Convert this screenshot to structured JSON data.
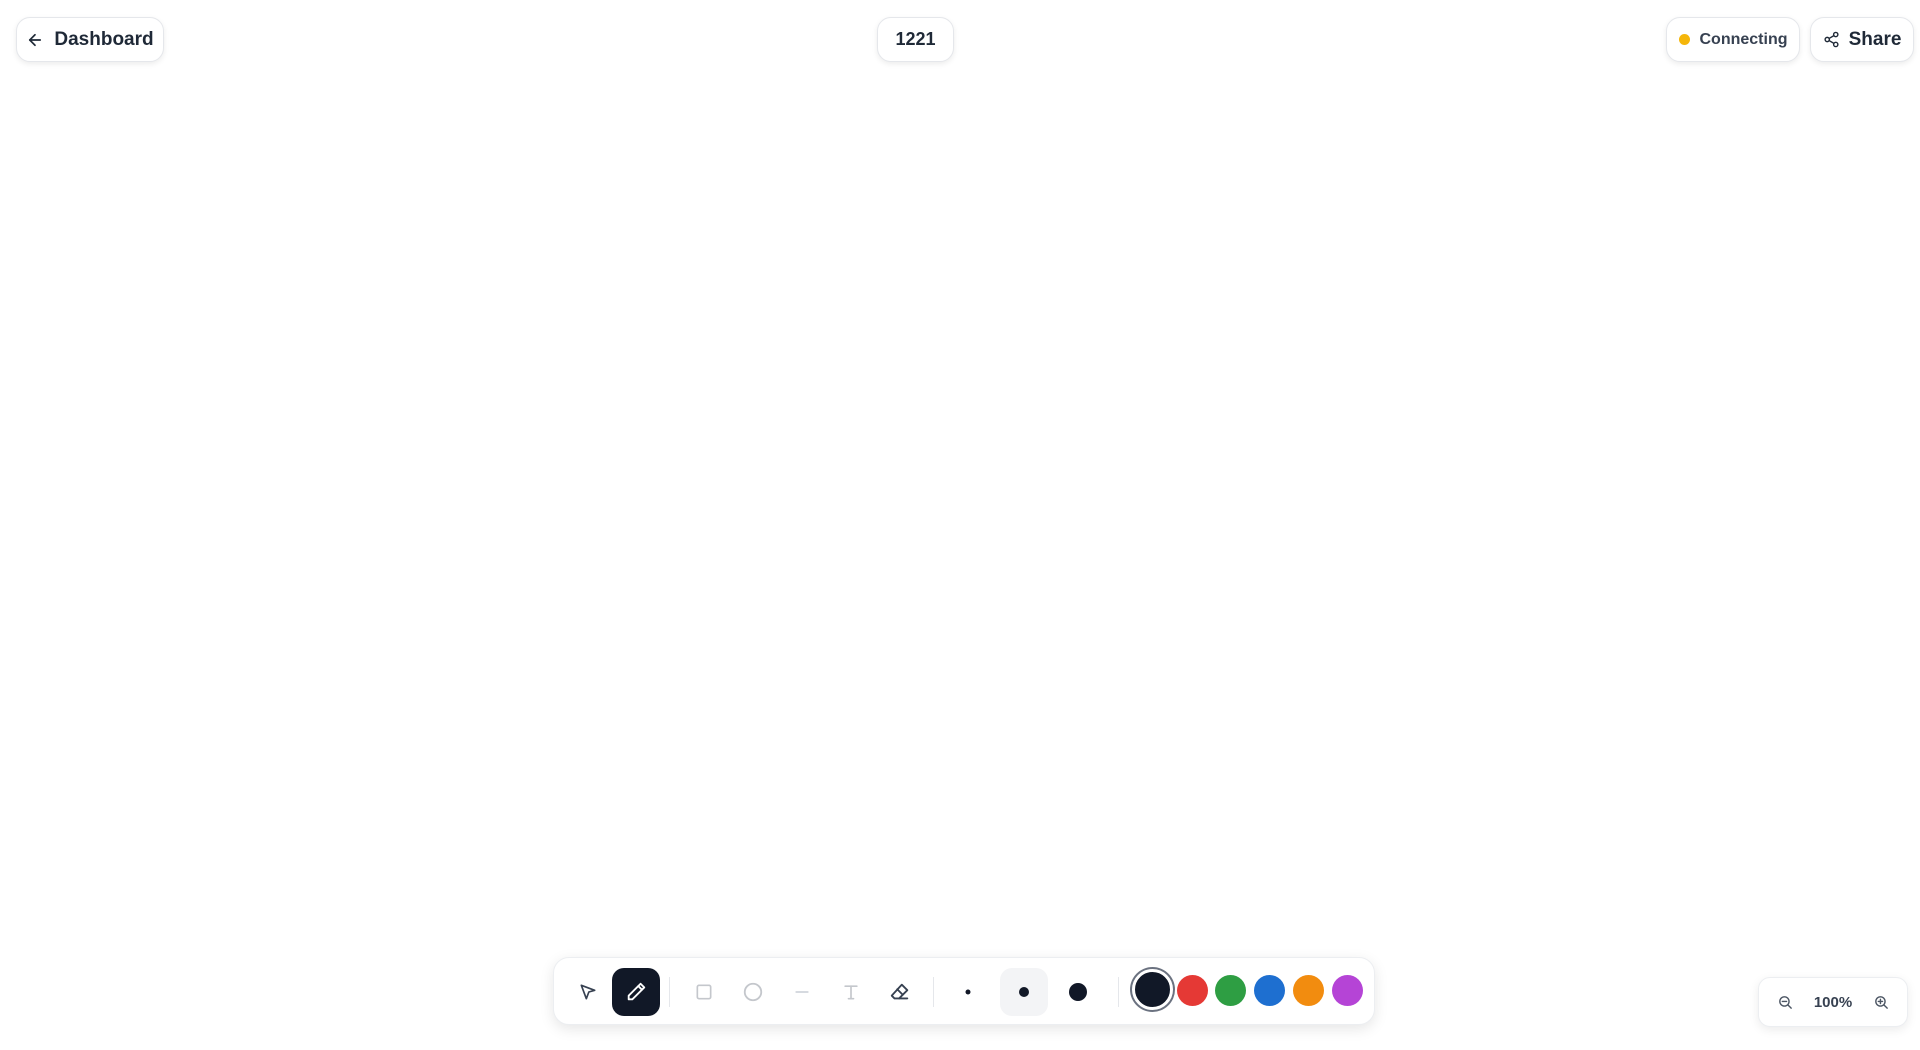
{
  "header": {
    "back_label": "Dashboard",
    "room_id": "1221",
    "status_label": "Connecting",
    "status_color": "#f5b60a",
    "share_label": "Share"
  },
  "toolbar": {
    "tools": [
      {
        "name": "select",
        "icon": "pointer-icon",
        "active": false
      },
      {
        "name": "pen",
        "icon": "pencil-icon",
        "active": true
      },
      {
        "name": "rectangle",
        "icon": "square-icon",
        "active": false
      },
      {
        "name": "ellipse",
        "icon": "circle-icon",
        "active": false
      },
      {
        "name": "line",
        "icon": "minus-icon",
        "active": false
      },
      {
        "name": "text",
        "icon": "type-icon",
        "active": false
      },
      {
        "name": "eraser",
        "icon": "eraser-icon",
        "active": false
      }
    ],
    "stroke_sizes": [
      {
        "name": "small",
        "active": false
      },
      {
        "name": "medium",
        "active": true
      },
      {
        "name": "large",
        "active": false
      }
    ],
    "colors": [
      {
        "name": "black",
        "hex": "#111827",
        "selected": true
      },
      {
        "name": "red",
        "hex": "#e53935",
        "selected": false
      },
      {
        "name": "green",
        "hex": "#2e9e43",
        "selected": false
      },
      {
        "name": "blue",
        "hex": "#1e6fd0",
        "selected": false
      },
      {
        "name": "orange",
        "hex": "#f28c0f",
        "selected": false
      },
      {
        "name": "purple",
        "hex": "#b544d6",
        "selected": false
      }
    ]
  },
  "zoom": {
    "level": "100%",
    "zoom_out_icon": "zoom-out-icon",
    "zoom_in_icon": "zoom-in-icon"
  }
}
